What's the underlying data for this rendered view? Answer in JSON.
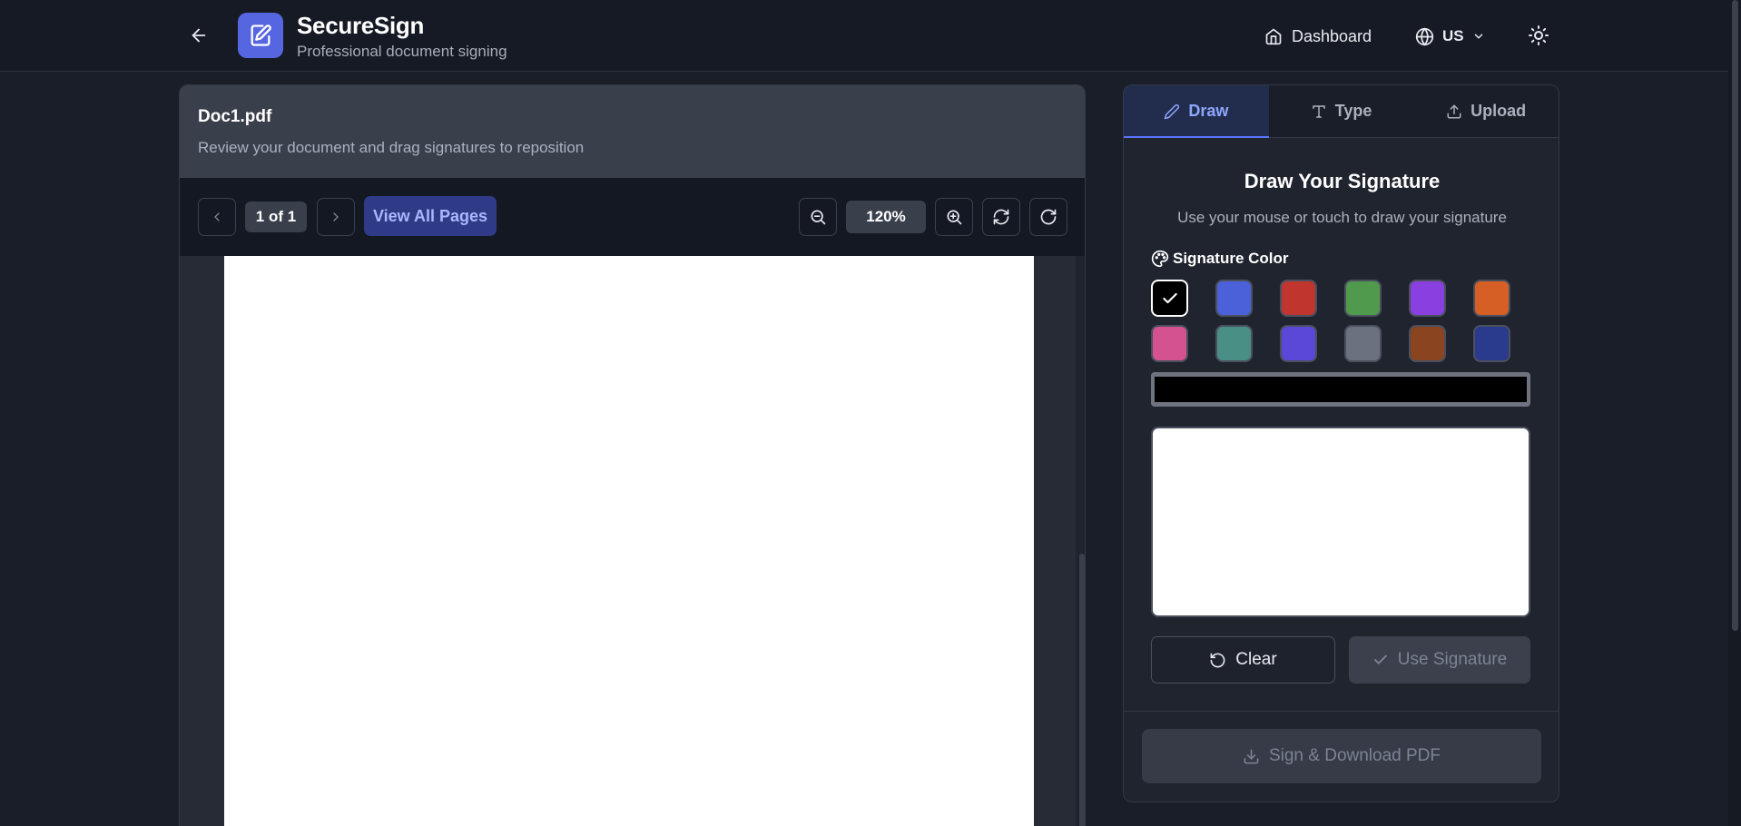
{
  "header": {
    "app_title": "SecureSign",
    "app_subtitle": "Professional document signing",
    "nav_dashboard": "Dashboard",
    "lang_label": "US",
    "icons": [
      "arrow-left-icon",
      "file-signature-icon",
      "home-icon",
      "globe-icon",
      "chevron-down-icon",
      "sun-icon"
    ]
  },
  "document": {
    "file_name": "Doc1.pdf",
    "description": "Review your document and drag signatures to reposition",
    "page_indicator": "1 of 1",
    "view_all_label": "View All Pages",
    "zoom": "120%"
  },
  "signature": {
    "tabs": [
      {
        "label": "Draw",
        "icon": "pen-icon",
        "active": true
      },
      {
        "label": "Type",
        "icon": "type-icon",
        "active": false
      },
      {
        "label": "Upload",
        "icon": "upload-icon",
        "active": false
      }
    ],
    "title": "Draw Your Signature",
    "subtitle": "Use your mouse or touch to draw your signature",
    "color_label": "Signature Color",
    "colors": [
      "#000000",
      "#4a61d9",
      "#c0362f",
      "#4f9a4c",
      "#8a3fe0",
      "#d65f25",
      "#d4528f",
      "#4a8f86",
      "#5b48d9",
      "#6b717f",
      "#8a4520",
      "#2a3a8c"
    ],
    "selected_color": "#000000",
    "clear_label": "Clear",
    "use_label": "Use Signature",
    "download_label": "Sign & Download PDF"
  },
  "theme": {
    "accent": "#5566e0",
    "background": "#1a1e29"
  }
}
